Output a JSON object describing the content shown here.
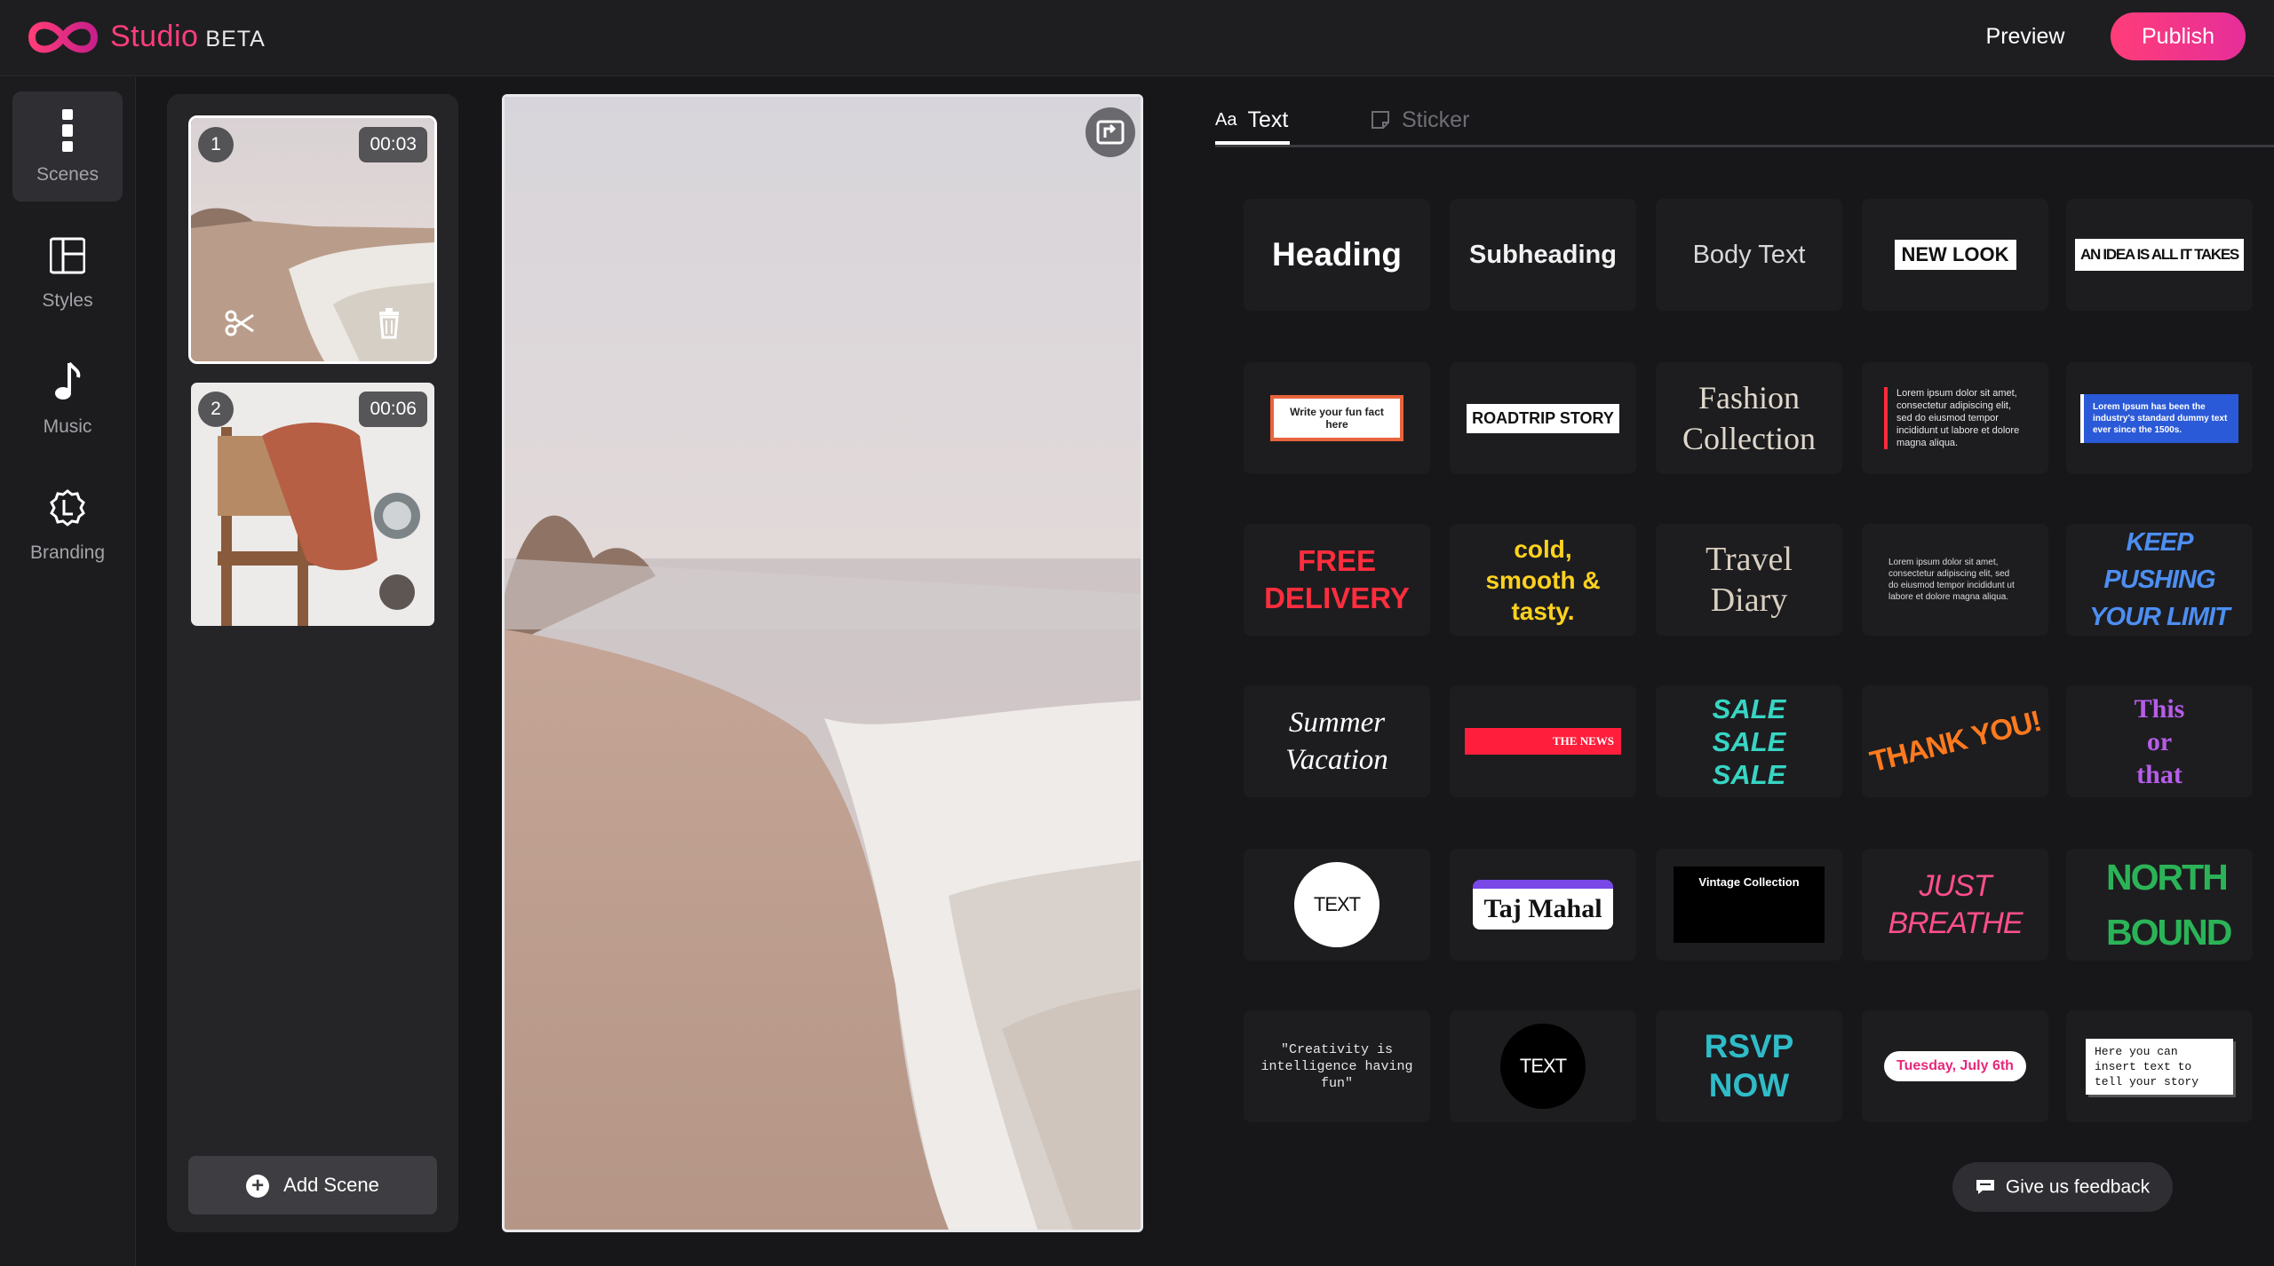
{
  "header": {
    "brand": "Studio",
    "beta": "BETA",
    "preview_label": "Preview",
    "publish_label": "Publish"
  },
  "rail": {
    "items": [
      {
        "label": "Scenes",
        "icon": "scenes-icon"
      },
      {
        "label": "Styles",
        "icon": "layout-icon"
      },
      {
        "label": "Music",
        "icon": "music-note-icon"
      },
      {
        "label": "Branding",
        "icon": "branding-badge-icon"
      }
    ]
  },
  "scenes": {
    "items": [
      {
        "number": "1",
        "duration": "00:03"
      },
      {
        "number": "2",
        "duration": "00:06"
      }
    ],
    "add_label": "Add Scene"
  },
  "tabs": {
    "text": {
      "icon": "Aa",
      "label": "Text"
    },
    "sticker": {
      "label": "Sticker"
    }
  },
  "text_styles": [
    "Heading",
    "Subheading",
    "Body Text",
    "NEW LOOK",
    "AN IDEA IS ALL IT TAKES",
    "Write your fun fact here",
    "ROADTRIP STORY",
    "Fashion Collection",
    "Lorem ipsum dolor sit amet, consectetur adipiscing elit, sed do eiusmod tempor incididunt ut labore et dolore magna aliqua.",
    "Lorem Ipsum has been the industry's standard dummy text ever since the 1500s.",
    "FREE DELIVERY",
    "cold, smooth & tasty.",
    "Travel Diary",
    "Lorem ipsum dolor sit amet, consectetur adipiscing elit, sed do eiusmod tempor incididunt ut labore et dolore magna aliqua.",
    "KEEP PUSHING YOUR LIMIT",
    "Summer Vacation",
    "THE NEWS",
    "SALE SALE SALE",
    "THANK YOU!",
    "This or that",
    "TEXT",
    "Taj Mahal",
    "Vintage Collection",
    "JUST BREATHE",
    "NORTH BOUND",
    "\"Creativity is intelligence having fun\"",
    "TEXT",
    "RSVP NOW",
    "Tuesday, July 6th",
    "Here you can insert text to tell your story"
  ],
  "feedback_label": "Give us feedback",
  "colors": {
    "accent": "#ff3d7a",
    "publish_gradient_end": "#e62e9a",
    "background": "#17171a"
  }
}
